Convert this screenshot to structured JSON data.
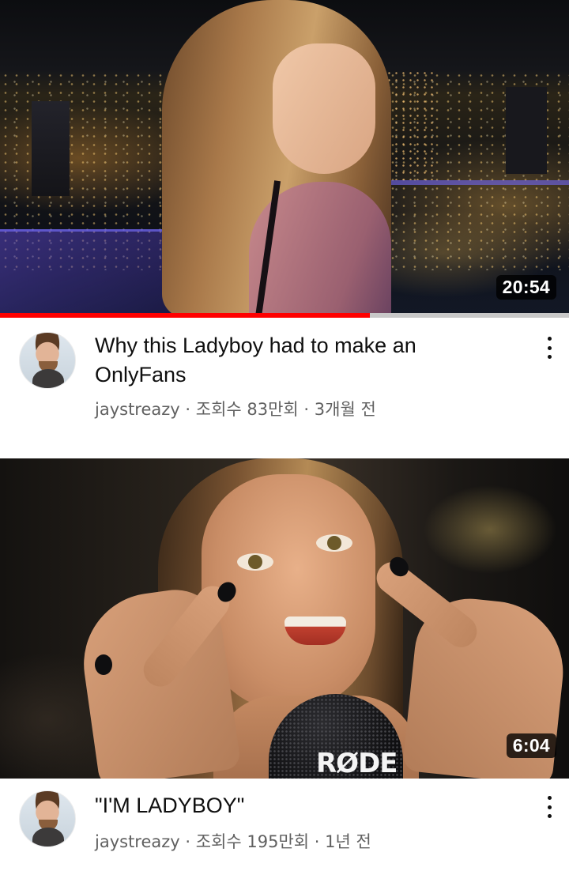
{
  "feed": {
    "videos": [
      {
        "duration": "20:54",
        "watch_progress_percent": 65,
        "title": "Why this Ladyboy had to make an OnlyFans",
        "channel": "jaystreazy",
        "views": "조회수 83만회",
        "age": "3개월 전",
        "separator": " · "
      },
      {
        "duration": "6:04",
        "title": "\"I'M LADYBOY\"",
        "channel": "jaystreazy",
        "views": "조회수 195만회",
        "age": "1년 전",
        "separator": " · ",
        "thumbnail_text": "RØDE"
      }
    ]
  },
  "icons": {
    "more": "more-vertical-icon",
    "avatar": "channel-avatar"
  },
  "colors": {
    "progress": "#ff0000",
    "title": "#0f0f0f",
    "meta": "#606060"
  }
}
